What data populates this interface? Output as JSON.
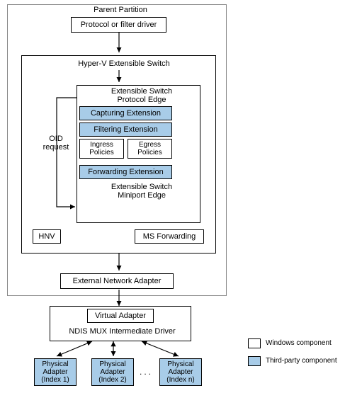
{
  "parent_partition_label": "Parent Partition",
  "protocol_driver": "Protocol or filter driver",
  "hyperv_switch": "Hyper-V Extensible Switch",
  "protocol_edge_l1": "Extensible Switch",
  "protocol_edge_l2": "Protocol Edge",
  "capturing_ext": "Capturing Extension",
  "filtering_ext": "Filtering Extension",
  "ingress_l1": "Ingress",
  "ingress_l2": "Policies",
  "egress_l1": "Egress",
  "egress_l2": "Policies",
  "forwarding_ext": "Forwarding Extension",
  "miniport_edge_l1": "Extensible Switch",
  "miniport_edge_l2": "Miniport Edge",
  "oid_l1": "OID",
  "oid_l2": "request",
  "hnv": "HNV",
  "ms_forwarding": "MS Forwarding",
  "external_adapter": "External Network Adapter",
  "virtual_adapter": "Virtual Adapter",
  "ndis_mux": "NDIS MUX Intermediate Driver",
  "phys1_l1": "Physical",
  "phys1_l2": "Adapter",
  "phys1_l3": "(Index 1)",
  "phys2_l1": "Physical",
  "phys2_l2": "Adapter",
  "phys2_l3": "(Index 2)",
  "physn_l1": "Physical",
  "physn_l2": "Adapter",
  "physn_l3": "(Index n)",
  "legend_windows": "Windows component",
  "legend_thirdparty": "Third-party component",
  "chart_data": {
    "type": "diagram",
    "title": "Hyper-V Extensible Switch Architecture",
    "nodes": [
      {
        "id": "parent_partition",
        "label": "Parent Partition",
        "kind": "container"
      },
      {
        "id": "protocol_driver",
        "label": "Protocol or filter driver",
        "kind": "windows"
      },
      {
        "id": "hyperv_switch",
        "label": "Hyper-V Extensible Switch",
        "kind": "container"
      },
      {
        "id": "protocol_edge",
        "label": "Extensible Switch Protocol Edge",
        "kind": "windows"
      },
      {
        "id": "capturing_ext",
        "label": "Capturing Extension",
        "kind": "thirdparty"
      },
      {
        "id": "filtering_ext",
        "label": "Filtering Extension",
        "kind": "thirdparty"
      },
      {
        "id": "ingress_policies",
        "label": "Ingress Policies",
        "kind": "windows"
      },
      {
        "id": "egress_policies",
        "label": "Egress Policies",
        "kind": "windows"
      },
      {
        "id": "forwarding_ext",
        "label": "Forwarding Extension",
        "kind": "thirdparty"
      },
      {
        "id": "miniport_edge",
        "label": "Extensible Switch Miniport Edge",
        "kind": "windows"
      },
      {
        "id": "hnv",
        "label": "HNV",
        "kind": "windows"
      },
      {
        "id": "ms_forwarding",
        "label": "MS Forwarding",
        "kind": "windows"
      },
      {
        "id": "external_adapter",
        "label": "External Network Adapter",
        "kind": "windows"
      },
      {
        "id": "virtual_adapter",
        "label": "Virtual Adapter",
        "kind": "windows"
      },
      {
        "id": "ndis_mux",
        "label": "NDIS MUX Intermediate Driver",
        "kind": "container"
      },
      {
        "id": "phys1",
        "label": "Physical Adapter (Index 1)",
        "kind": "thirdparty"
      },
      {
        "id": "phys2",
        "label": "Physical Adapter (Index 2)",
        "kind": "thirdparty"
      },
      {
        "id": "physn",
        "label": "Physical Adapter (Index n)",
        "kind": "thirdparty"
      }
    ],
    "edges": [
      {
        "from": "protocol_driver",
        "to": "hyperv_switch",
        "dir": "down"
      },
      {
        "from": "hyperv_switch",
        "to": "protocol_edge",
        "dir": "down"
      },
      {
        "from": "protocol_edge",
        "to": "miniport_edge",
        "dir": "down",
        "label": "OID request",
        "path": "left-side"
      },
      {
        "from": "hyperv_switch",
        "to": "external_adapter",
        "dir": "down"
      },
      {
        "from": "external_adapter",
        "to": "ndis_mux",
        "dir": "down"
      },
      {
        "from": "ndis_mux",
        "to": "phys1",
        "dir": "both"
      },
      {
        "from": "ndis_mux",
        "to": "phys2",
        "dir": "both"
      },
      {
        "from": "ndis_mux",
        "to": "physn",
        "dir": "both"
      }
    ],
    "legend": [
      {
        "swatch": "white",
        "label": "Windows component"
      },
      {
        "swatch": "#a8cce8",
        "label": "Third-party component"
      }
    ]
  }
}
